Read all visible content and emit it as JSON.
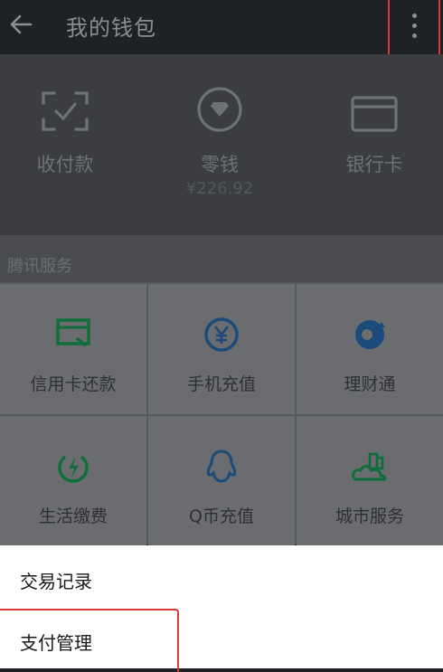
{
  "header": {
    "title": "我的钱包"
  },
  "wallet": {
    "items": [
      {
        "label": "收付款",
        "icon": "scan-pay-icon"
      },
      {
        "label": "零钱",
        "sub": "¥226.92",
        "icon": "coin-icon"
      },
      {
        "label": "银行卡",
        "icon": "bank-card-icon"
      }
    ]
  },
  "services": {
    "section_title": "腾讯服务",
    "items": [
      {
        "label": "信用卡还款",
        "icon": "credit-card-repay-icon"
      },
      {
        "label": "手机充值",
        "icon": "yen-coin-icon"
      },
      {
        "label": "理财通",
        "icon": "wealth-icon"
      },
      {
        "label": "生活缴费",
        "icon": "utility-bill-icon"
      },
      {
        "label": "Q币充值",
        "icon": "qq-penguin-icon"
      },
      {
        "label": "城市服务",
        "icon": "city-service-icon"
      }
    ]
  },
  "menu": {
    "items": [
      {
        "label": "交易记录"
      },
      {
        "label": "支付管理"
      }
    ]
  },
  "colors": {
    "accent_green": "#0f6e3a",
    "accent_blue": "#1b4b7a",
    "highlight_red": "#d63a3a"
  }
}
